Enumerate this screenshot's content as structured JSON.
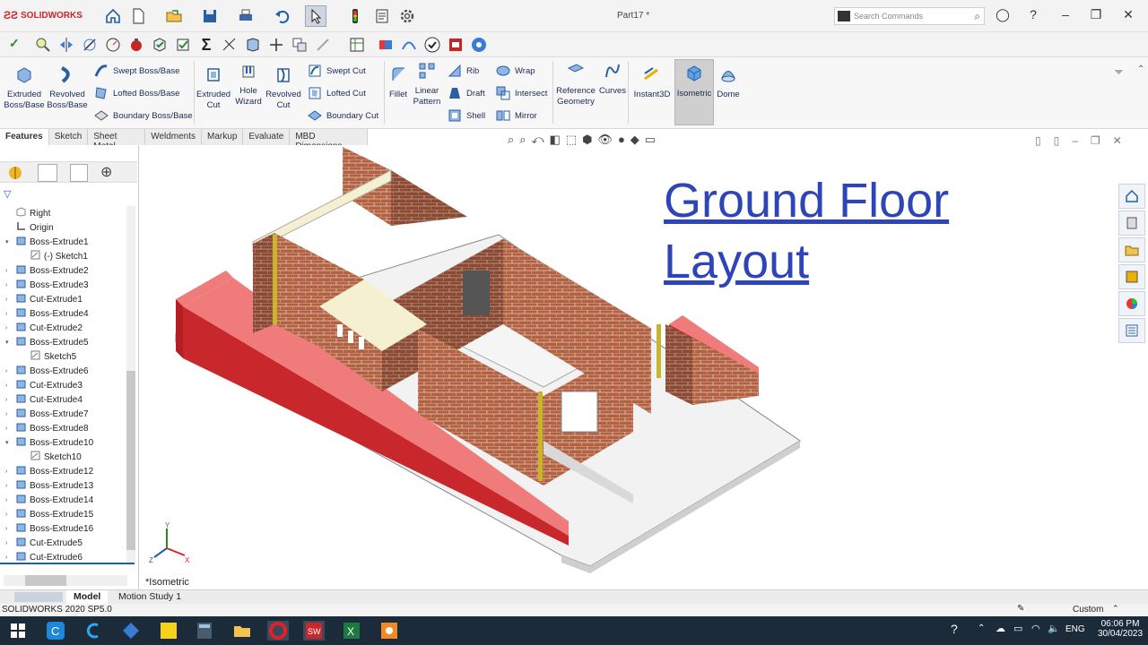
{
  "app": {
    "logo": "SOLIDWORKS",
    "doc_title": "Part17 *"
  },
  "search": {
    "placeholder": "Search Commands"
  },
  "ribbon": {
    "extruded_boss": "Extruded Boss/Base",
    "revolved_boss": "Revolved Boss/Base",
    "swept_boss": "Swept Boss/Base",
    "lofted_boss": "Lofted Boss/Base",
    "boundary_boss": "Boundary Boss/Base",
    "extruded_cut": "Extruded Cut",
    "hole_wizard": "Hole Wizard",
    "revolved_cut": "Revolved Cut",
    "swept_cut": "Swept Cut",
    "lofted_cut": "Lofted Cut",
    "boundary_cut": "Boundary Cut",
    "fillet": "Fillet",
    "linear_pattern": "Linear Pattern",
    "rib": "Rib",
    "draft": "Draft",
    "shell": "Shell",
    "wrap": "Wrap",
    "intersect": "Intersect",
    "mirror": "Mirror",
    "reference_geometry": "Reference Geometry",
    "curves": "Curves",
    "instant3d": "Instant3D",
    "isometric": "Isometric",
    "dome": "Dome"
  },
  "tabs": [
    "Features",
    "Sketch",
    "Sheet Metal",
    "Weldments",
    "Markup",
    "Evaluate",
    "MBD Dimensions"
  ],
  "tree": [
    {
      "label": "Right",
      "icon": "plane",
      "arrow": "",
      "indent": 0
    },
    {
      "label": "Origin",
      "icon": "origin",
      "arrow": "",
      "indent": 0
    },
    {
      "label": "Boss-Extrude1",
      "icon": "feature",
      "arrow": "▾",
      "indent": 0
    },
    {
      "label": "(-) Sketch1",
      "icon": "sketch",
      "arrow": "",
      "indent": 1
    },
    {
      "label": "Boss-Extrude2",
      "icon": "feature",
      "arrow": "›",
      "indent": 0
    },
    {
      "label": "Boss-Extrude3",
      "icon": "feature",
      "arrow": "›",
      "indent": 0
    },
    {
      "label": "Cut-Extrude1",
      "icon": "feature",
      "arrow": "›",
      "indent": 0
    },
    {
      "label": "Boss-Extrude4",
      "icon": "feature",
      "arrow": "›",
      "indent": 0
    },
    {
      "label": "Cut-Extrude2",
      "icon": "feature",
      "arrow": "›",
      "indent": 0
    },
    {
      "label": "Boss-Extrude5",
      "icon": "feature",
      "arrow": "▾",
      "indent": 0
    },
    {
      "label": "Sketch5",
      "icon": "sketch",
      "arrow": "",
      "indent": 1
    },
    {
      "label": "Boss-Extrude6",
      "icon": "feature",
      "arrow": "›",
      "indent": 0
    },
    {
      "label": "Cut-Extrude3",
      "icon": "feature",
      "arrow": "›",
      "indent": 0
    },
    {
      "label": "Cut-Extrude4",
      "icon": "feature",
      "arrow": "›",
      "indent": 0
    },
    {
      "label": "Boss-Extrude7",
      "icon": "feature",
      "arrow": "›",
      "indent": 0
    },
    {
      "label": "Boss-Extrude8",
      "icon": "feature",
      "arrow": "›",
      "indent": 0
    },
    {
      "label": "Boss-Extrude10",
      "icon": "feature",
      "arrow": "▾",
      "indent": 0
    },
    {
      "label": "Sketch10",
      "icon": "sketch",
      "arrow": "",
      "indent": 1
    },
    {
      "label": "Boss-Extrude12",
      "icon": "feature",
      "arrow": "›",
      "indent": 0
    },
    {
      "label": "Boss-Extrude13",
      "icon": "feature",
      "arrow": "›",
      "indent": 0
    },
    {
      "label": "Boss-Extrude14",
      "icon": "feature",
      "arrow": "›",
      "indent": 0
    },
    {
      "label": "Boss-Extrude15",
      "icon": "feature",
      "arrow": "›",
      "indent": 0
    },
    {
      "label": "Boss-Extrude16",
      "icon": "feature",
      "arrow": "›",
      "indent": 0
    },
    {
      "label": "Cut-Extrude5",
      "icon": "feature",
      "arrow": "›",
      "indent": 0
    },
    {
      "label": "Cut-Extrude6",
      "icon": "feature",
      "arrow": "›",
      "indent": 0
    }
  ],
  "viewport": {
    "heading_line1": "Ground Floor",
    "heading_line2": "Layout",
    "view_label": "*Isometric",
    "triad": {
      "x": "X",
      "y": "Y",
      "z": "Z"
    }
  },
  "bottom_tabs": {
    "model": "Model",
    "motion": "Motion Study 1"
  },
  "status": {
    "version": "SOLIDWORKS 2020 SP5.0",
    "units": "Custom"
  },
  "taskbar": {
    "lang": "ENG",
    "time": "06:06 PM",
    "date": "30/04/2023"
  },
  "colors": {
    "heading": "#2e45b8",
    "brick": "#b05a3c",
    "red_wall": "#c8272b",
    "accent": "#1f5fa8"
  }
}
